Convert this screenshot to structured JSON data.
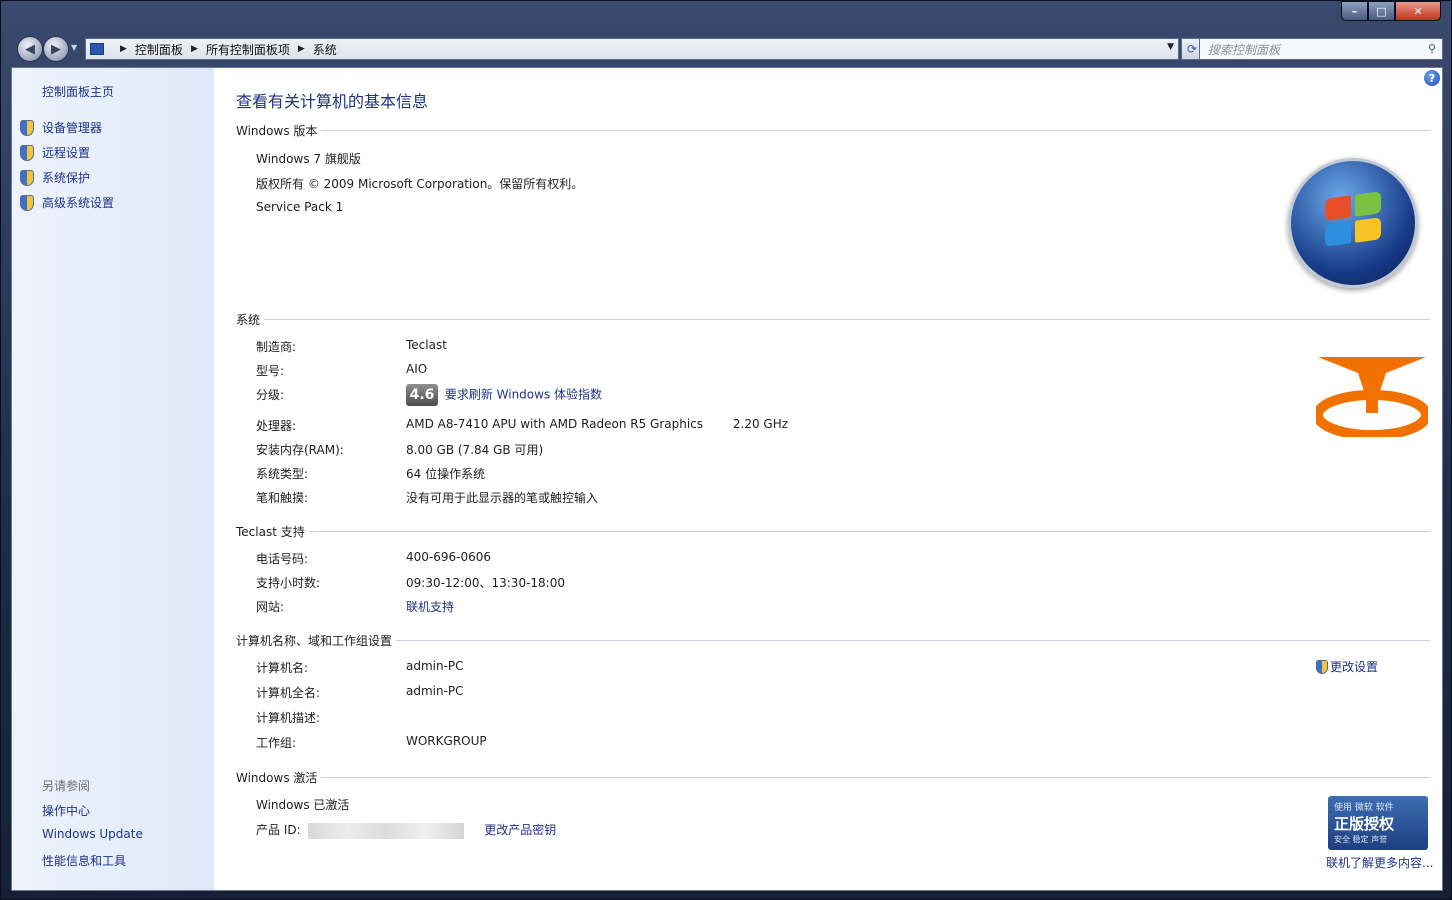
{
  "window": {
    "caption": {
      "minimize": "–",
      "maximize": "□",
      "close": "✕"
    }
  },
  "address": {
    "crumbs": [
      "控制面板",
      "所有控制面板项",
      "系统"
    ],
    "search_placeholder": "搜索控制面板"
  },
  "sidebar": {
    "home": "控制面板主页",
    "tasks": [
      "设备管理器",
      "远程设置",
      "系统保护",
      "高级系统设置"
    ],
    "see_also_title": "另请参阅",
    "see_also": [
      "操作中心",
      "Windows Update",
      "性能信息和工具"
    ]
  },
  "main": {
    "title": "查看有关计算机的基本信息",
    "edition": {
      "heading": "Windows 版本",
      "name": "Windows 7 旗舰版",
      "copyright": "版权所有 © 2009 Microsoft Corporation。保留所有权利。",
      "service_pack": "Service Pack 1"
    },
    "system": {
      "heading": "系统",
      "manufacturer_label": "制造商:",
      "manufacturer": "Teclast",
      "model_label": "型号:",
      "model": "AIO",
      "rating_label": "分级:",
      "rating_score": "4.6",
      "rating_link": "要求刷新 Windows 体验指数",
      "processor_label": "处理器:",
      "processor": "AMD A8-7410 APU with AMD Radeon R5 Graphics",
      "processor_speed": "2.20 GHz",
      "ram_label": "安装内存(RAM):",
      "ram": "8.00 GB (7.84 GB 可用)",
      "type_label": "系统类型:",
      "type": "64 位操作系统",
      "pen_label": "笔和触摸:",
      "pen": "没有可用于此显示器的笔或触控输入"
    },
    "support": {
      "heading": "Teclast 支持",
      "phone_label": "电话号码:",
      "phone": "400-696-0606",
      "hours_label": "支持小时数:",
      "hours": "09:30-12:00、13:30-18:00",
      "website_label": "网站:",
      "website": "联机支持"
    },
    "computer": {
      "heading": "计算机名称、域和工作组设置",
      "name_label": "计算机名:",
      "name": "admin-PC",
      "fullname_label": "计算机全名:",
      "fullname": "admin-PC",
      "desc_label": "计算机描述:",
      "desc": "",
      "workgroup_label": "工作组:",
      "workgroup": "WORKGROUP",
      "change_settings": "更改设置"
    },
    "activation": {
      "heading": "Windows 激活",
      "status": "Windows 已激活",
      "pid_label": "产品 ID:",
      "change_key": "更改产品密钥",
      "genuine_line1": "使用 微软 软件",
      "genuine_line2": "正版授权",
      "genuine_line3": "安全 稳定 声誉",
      "genuine_link": "联机了解更多内容..."
    }
  },
  "colors": {
    "link": "#1e3287",
    "sidebar_bg": "#dde9f8",
    "teclast_orange": "#f07000"
  }
}
